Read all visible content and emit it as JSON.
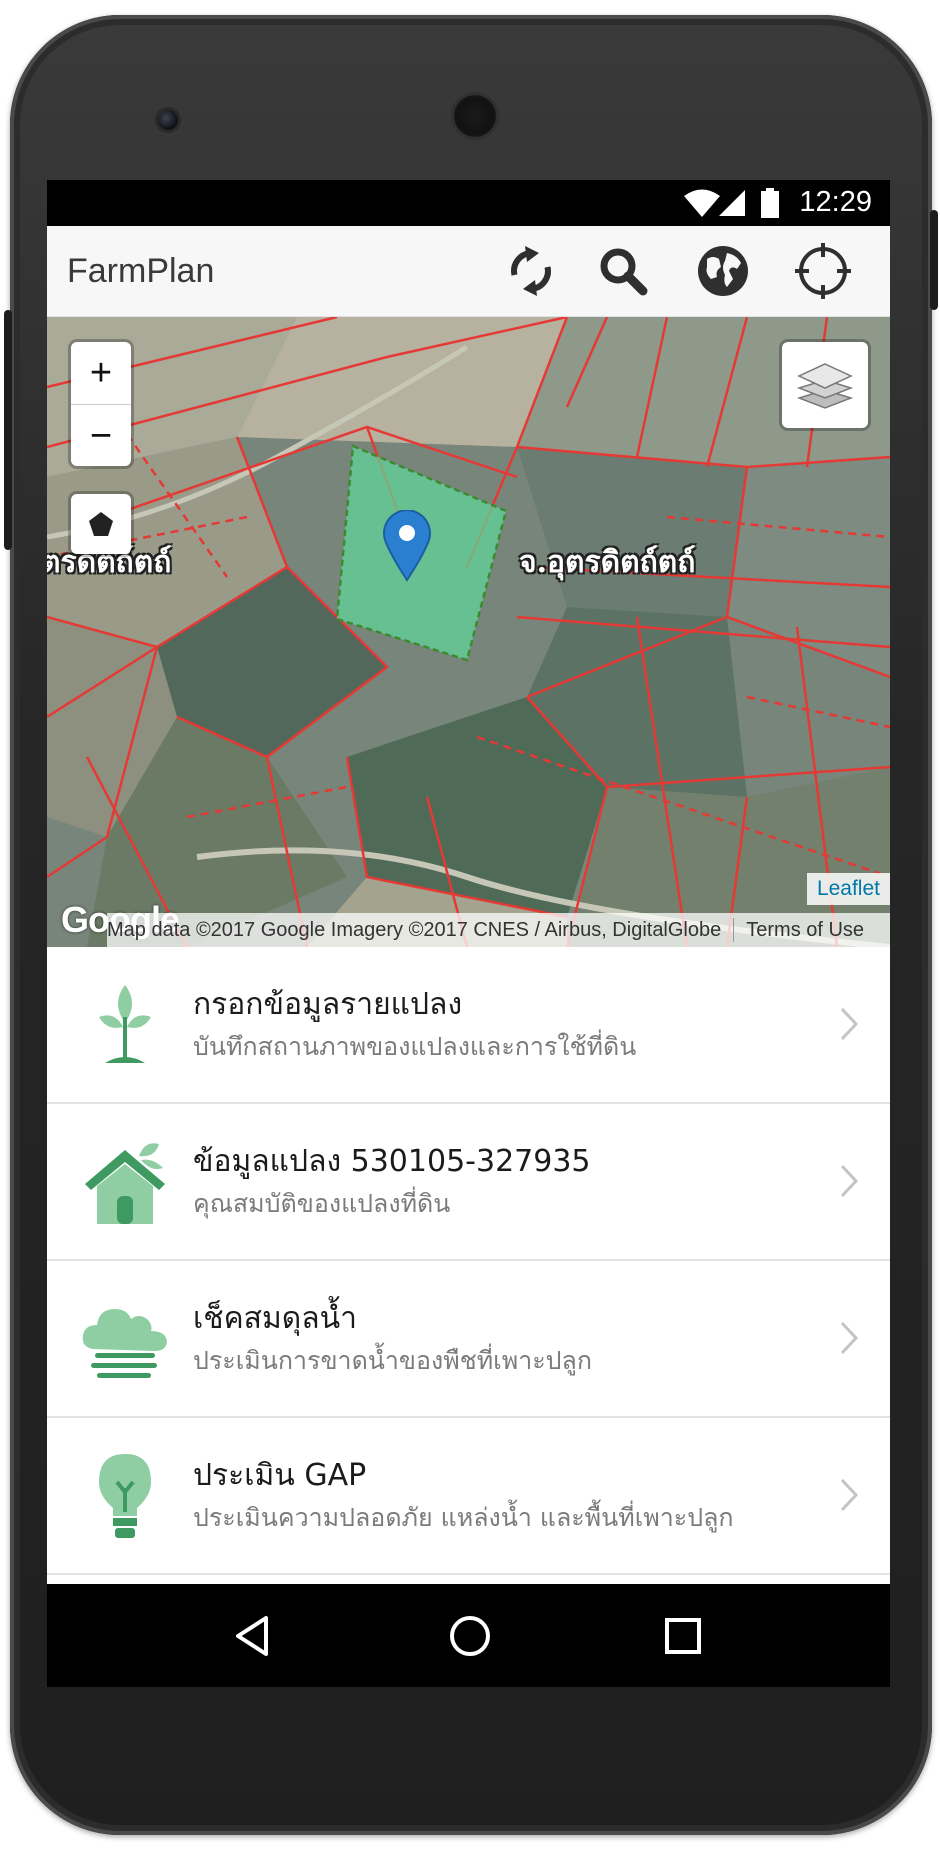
{
  "status": {
    "time": "12:29"
  },
  "app": {
    "title": "FarmPlan"
  },
  "map": {
    "zoom_in": "+",
    "zoom_out": "−",
    "labels": [
      "ตรดิตถ์ตถ์",
      "จ.อุตรดิตถ์ตถ์"
    ],
    "google": "Google",
    "attribution": "Map data ©2017 Google Imagery ©2017 CNES / Airbus, DigitalGlobe",
    "terms": "Terms of Use",
    "leaflet": "Leaflet",
    "colors": {
      "parcel_lines": "#e53935",
      "selected_fill": "#5fd79a",
      "marker": "#2a7fd1"
    }
  },
  "menu": [
    {
      "title": "กรอกข้อมูลรายแปลง",
      "subtitle": "บันทึกสถานภาพของแปลงและการใช้ที่ดิน",
      "icon": "plant-icon"
    },
    {
      "title": "ข้อมูลแปลง 530105-327935",
      "subtitle": "คุณสมบัติของแปลงที่ดิน",
      "icon": "farmhouse-icon"
    },
    {
      "title": "เช็คสมดุลน้ำ",
      "subtitle": "ประเมินการขาดน้ำของพืชที่เพาะปลูก",
      "icon": "cloud-water-icon"
    },
    {
      "title": "ประเมิน GAP",
      "subtitle": "ประเมินความปลอดภัย แหล่งน้ำ และพื้นที่เพาะปลูก",
      "icon": "lightbulb-plant-icon"
    }
  ],
  "theme": {
    "accent_green": "#3f9a61",
    "light_green": "#8fcea3"
  }
}
